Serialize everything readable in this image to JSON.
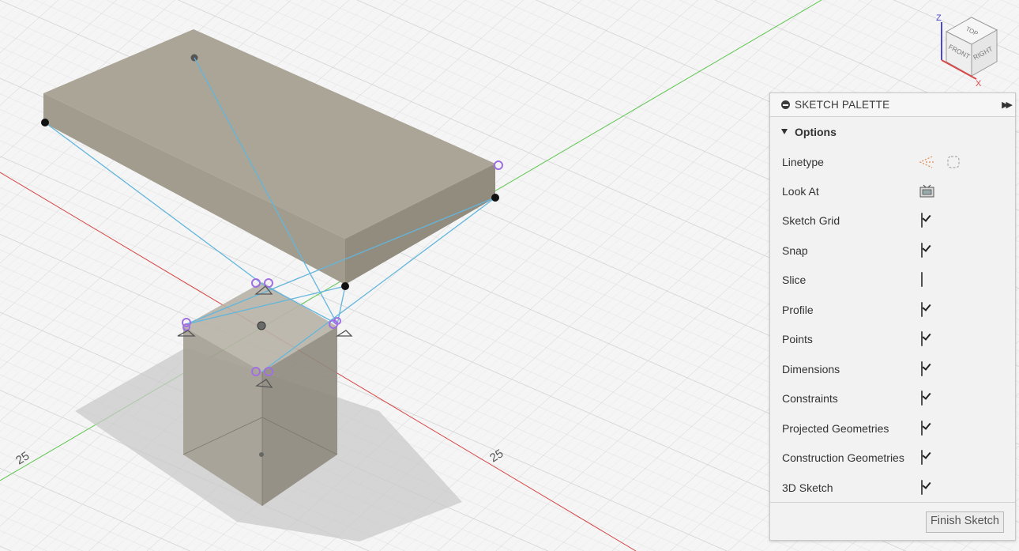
{
  "viewport": {
    "axis_labels": [
      "25",
      "25"
    ],
    "viewcube": {
      "faces": [
        "TOP",
        "FRONT",
        "RIGHT"
      ],
      "axes": [
        "Z",
        "X"
      ]
    }
  },
  "palette": {
    "title": "SKETCH PALETTE",
    "section_title": "Options",
    "options": [
      {
        "label": "Linetype",
        "control": "linetype-icons"
      },
      {
        "label": "Look At",
        "control": "look-at-icon"
      },
      {
        "label": "Sketch Grid",
        "control": "checkbox",
        "checked": true
      },
      {
        "label": "Snap",
        "control": "checkbox",
        "checked": true
      },
      {
        "label": "Slice",
        "control": "checkbox",
        "checked": false
      },
      {
        "label": "Profile",
        "control": "checkbox",
        "checked": true
      },
      {
        "label": "Points",
        "control": "checkbox",
        "checked": true
      },
      {
        "label": "Dimensions",
        "control": "checkbox",
        "checked": true
      },
      {
        "label": "Constraints",
        "control": "checkbox",
        "checked": true
      },
      {
        "label": "Projected Geometries",
        "control": "checkbox",
        "checked": true
      },
      {
        "label": "Construction Geometries",
        "control": "checkbox",
        "checked": true
      },
      {
        "label": "3D Sketch",
        "control": "checkbox",
        "checked": true
      }
    ],
    "finish_label": "Finish Sketch"
  },
  "colors": {
    "grid": "#dcdcdc",
    "x_axis": "#d64545",
    "y_axis": "#59c54a",
    "sketch_line": "#62b6dd",
    "constraint": "#a070e0",
    "body_face": "#a8a293"
  }
}
